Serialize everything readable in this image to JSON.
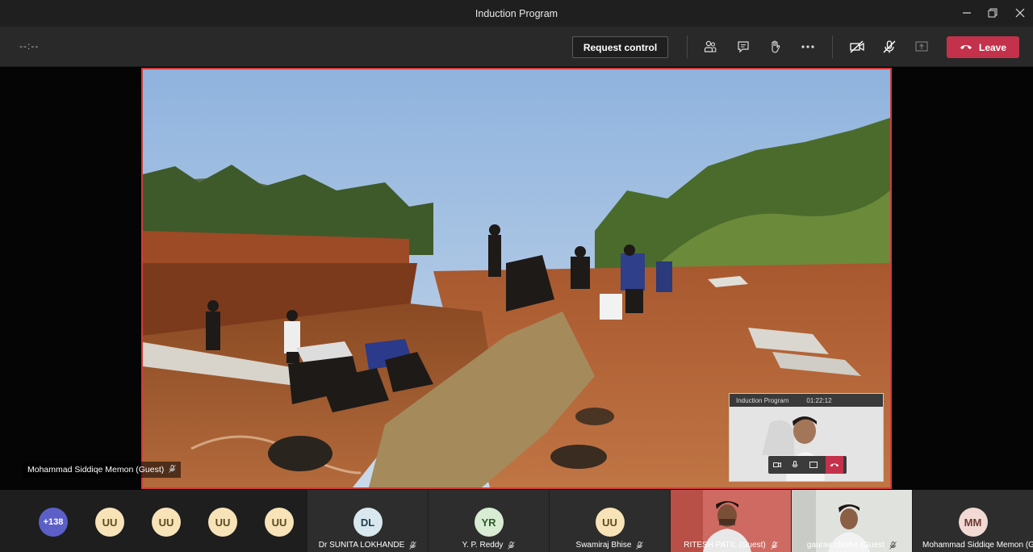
{
  "window": {
    "title": "Induction Program"
  },
  "toolbar": {
    "timer": "--:--",
    "request_control": "Request control",
    "leave": "Leave"
  },
  "stage": {
    "speaker_name": "Mohammad Siddiqe Memon (Guest)"
  },
  "selfview": {
    "title": "Induction Program",
    "time": "01:22:12"
  },
  "gallery": {
    "more": "+138",
    "uu": [
      "UU",
      "UU",
      "UU",
      "UU"
    ],
    "tiles": [
      {
        "initials": "DL",
        "name": "Dr SUNITA LOKHANDE",
        "color": "#d9e8ef"
      },
      {
        "initials": "YR",
        "name": "Y. P. Reddy",
        "color": "#d7ecd3"
      },
      {
        "initials": "UU",
        "name": "Swamiraj Bhise",
        "color": "#f8e3b8"
      },
      {
        "initials": "",
        "name": "RITESH PATIL (Guest)",
        "color": ""
      },
      {
        "initials": "",
        "name": "gaurav chothe (Guest",
        "color": ""
      },
      {
        "initials": "MM",
        "name": "Mohammad Siddiqe Memon (G",
        "color": "#f2d9d3"
      }
    ]
  },
  "colors": {
    "leave": "#c4314b",
    "highlight_border": "#d33a3a",
    "more_badge": "#5b5fc7"
  }
}
